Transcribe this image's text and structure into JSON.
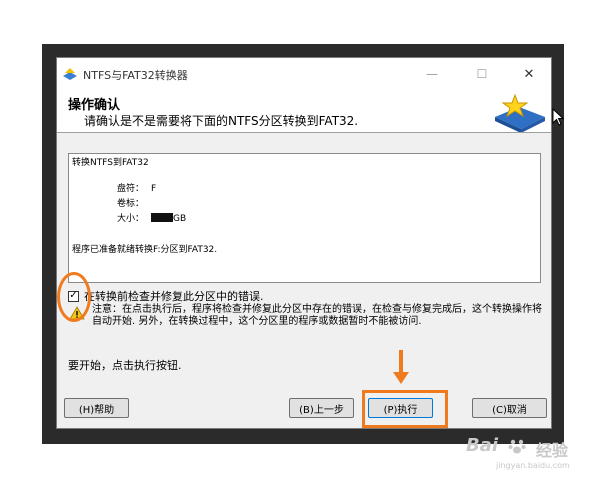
{
  "window": {
    "title": "NTFS与FAT32转换器",
    "controls": {
      "minimize": "—",
      "maximize": "☐",
      "close": "✕"
    }
  },
  "header": {
    "title": "操作确认",
    "subtitle": "请确认是不是需要将下面的NTFS分区转换到FAT32."
  },
  "details": {
    "heading": "转换NTFS到FAT32",
    "drive_label": "盘符：",
    "drive_value": "F",
    "volume_label": "卷标：",
    "volume_value": "",
    "size_label": "大小：",
    "size_unit": "GB",
    "ready_text": "程序已准备就绪转换F:分区到FAT32."
  },
  "options": {
    "check_before": {
      "label": "在转换前检查并修复此分区中的错误.",
      "checked": true,
      "mark": "✓"
    }
  },
  "warning": {
    "text": "注意：在点击执行后，程序将检查并修复此分区中存在的错误，在检查与修复完成后，这个转换操作将自动开始. 另外，在转换过程中，这个分区里的程序或数据暂时不能被访问."
  },
  "instruction": "要开始，点击执行按钮.",
  "buttons": {
    "help": "(H)帮助",
    "prev": "(B)上一步",
    "exec": "(P)执行",
    "cancel": "(C)取消"
  },
  "watermark": {
    "brand": "Bai",
    "cn": "经验",
    "url": "jingyan.baidu.com"
  },
  "colors": {
    "annotation": "#f07a1e",
    "focus": "#0078d7"
  }
}
